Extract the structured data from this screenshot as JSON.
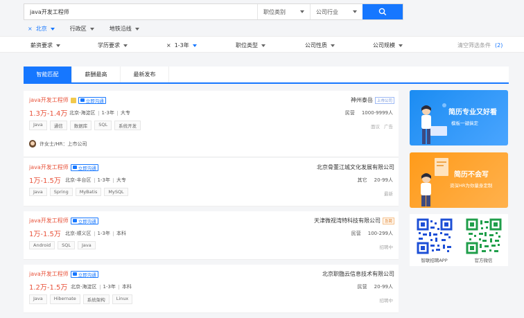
{
  "search": {
    "query": "java开发工程师",
    "category_label": "职位类别",
    "industry_label": "公司行业"
  },
  "filter_row1": {
    "city": "北京",
    "district": "行政区",
    "subway": "地铁沿线"
  },
  "filter_row2": {
    "salary": "薪资要求",
    "education": "学历要求",
    "experience": "1-3年",
    "job_type": "职位类型",
    "company_type": "公司性质",
    "company_size": "公司规模",
    "clear_label": "清空筛选条件",
    "clear_count": "(2)"
  },
  "tabs": [
    {
      "label": "智能匹配"
    },
    {
      "label": "薪酬最高"
    },
    {
      "label": "最新发布"
    }
  ],
  "jobs": [
    {
      "title": "java开发工程师",
      "chat": "立即沟通",
      "salary": "1.3万-1.4万",
      "location": "北京-海淀区",
      "experience": "1-3年",
      "education": "大专",
      "tags": [
        "Java",
        "通信",
        "数据库",
        "SQL",
        "系统开发"
      ],
      "company": "神州泰岳",
      "company_badge": "上市公司",
      "ownership": "民营",
      "size": "1000-9999人",
      "foot": [
        "面议",
        "广告"
      ],
      "hr": "许女士/HR：上市公司"
    },
    {
      "title": "java开发工程师",
      "chat": "立即沟通",
      "salary": "1万-1.5万",
      "location": "北京-丰台区",
      "experience": "1-3年",
      "education": "大专",
      "tags": [
        "Java",
        "Spring",
        "MyBatis",
        "MySQL"
      ],
      "company": "北京骨董江城文化发展有限公司",
      "ownership": "其它",
      "size": "20-99人",
      "foot": [
        "最新"
      ]
    },
    {
      "title": "java开发工程师",
      "chat": "立即沟通",
      "salary": "1万-1.5万",
      "location": "北京-顺义区",
      "experience": "1-3年",
      "education": "本科",
      "tags": [
        "Android",
        "SQL",
        "Java"
      ],
      "company": "天津微视湾特科技有限公司",
      "company_badge": "急聘",
      "ownership": "民营",
      "size": "100-299人",
      "foot": [
        "招聘中"
      ]
    },
    {
      "title": "java开发工程师",
      "chat": "立即沟通",
      "salary": "1.2万-1.5万",
      "location": "北京-海淀区",
      "experience": "1-3年",
      "education": "本科",
      "tags": [
        "Java",
        "Hibernate",
        "系统架构",
        "Linux"
      ],
      "company": "北京职臨云信息技术有限公司",
      "ownership": "民营",
      "size": "20-99人",
      "foot": [
        "招聘中"
      ]
    }
  ],
  "banners": [
    {
      "title": "简历专业又好看",
      "subtitle": "模板一键搞定"
    },
    {
      "title": "简历不会写",
      "subtitle": "资深HR为你量身定制"
    }
  ],
  "qr": [
    {
      "label": "智联招聘APP"
    },
    {
      "label": "官方微信"
    }
  ],
  "colors": {
    "accent": "#1677ff",
    "salary": "#e8523a",
    "banner_blue": "#1b8cf2",
    "banner_orange": "#ff9b1a"
  }
}
